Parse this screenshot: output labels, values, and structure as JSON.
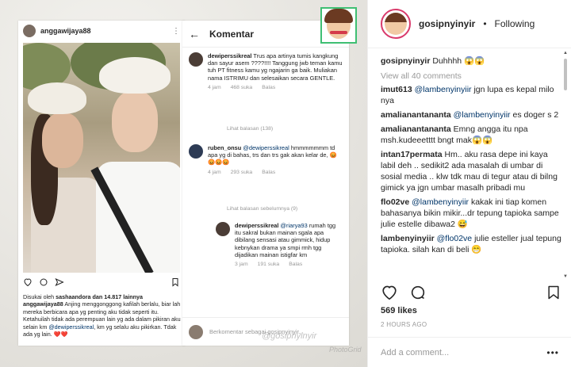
{
  "collage": {
    "post": {
      "username": "anggawijaya88",
      "more": "⋮",
      "liked_by_prefix": "Disukai oleh",
      "liked_by_user": "sashaandora",
      "liked_by_suffix": "dan 14.817 lainnya",
      "caption_user": "anggawijaya88",
      "caption": "Anjing menggonggong kafilah berlalu, biar lah mereka berbicara apa yg penting aku tidak seperti itu. Ketahuilah tidak ada perempuan lain yg ada dalam pikiran aku selain km",
      "caption_mention": "@dewiperssikreal",
      "caption_end": ", km yg selalu aku pikirkan. Tdak ada yg lain. ❤️❤️"
    },
    "comments_screen": {
      "back": "←",
      "title": "Komentar",
      "c1_user": "dewiperssikreal",
      "c1_text": "Trus apa artinya tumis kangkung dan sayur asem ????!!!! Tanggung jwb teman kamu tuh PT fitness kamu yg ngajarin ga baik. Muliakan nama ISTRIMU dan selesaikan secara GENTLE.",
      "c1_time": "4 jam",
      "c1_likes": "468 suka",
      "c1_reply": "Balas",
      "c1_view": "Lihat balasan (138)",
      "c2_user": "ruben_onsu",
      "c2_mention": "@dewiperssikreal",
      "c2_text": "hmmmmmmm td apa yg di bahas, trs dan trs gak akan kelar de,",
      "c2_emoji": "😡😡😡😡",
      "c2_time": "4 jam",
      "c2_likes": "293 suka",
      "c2_reply": "Balas",
      "c2_view": "Lihat balasan sebelumnya (9)",
      "c3_user": "dewiperssikreal",
      "c3_mention": "@riarya93",
      "c3_text": "rumah tgg itu sakral bukan mainan sgala apa dibilang sensasi atau gimmick, hidup kebnykan drama ya smpi rmh tgg dijadikan mainan istigfar km",
      "c3_time": "3 jam",
      "c3_likes": "191 suka",
      "c3_reply": "Balas",
      "footer_placeholder": "Berkomentar sebagai gosipnyinyir..."
    },
    "watermark": "@gosipnyinyir",
    "watermark2": "PhotoGrid"
  },
  "panel": {
    "username": "gosipnyinyir",
    "dot": "•",
    "follow_status": "Following",
    "caption_user": "gosipnyinyir",
    "caption_text": "Duhhhh 😱😱",
    "view_all": "View all 40 comments",
    "comments": [
      {
        "user": "imut613",
        "mention": "@lambenyinyiir",
        "text": "jgn lupa es kepal milo nya"
      },
      {
        "user": "amalianantananta",
        "mention": "@lambenyinyiir",
        "text": "es doger s 2"
      },
      {
        "user": "amalianantananta",
        "mention": "",
        "text": "Emng angga itu npa msh.kudeeetttt bngt mak😱😱"
      },
      {
        "user": "intan17permata",
        "mention": "",
        "text": "Hm.. aku rasa depe ini kaya labil deh .. sedikit2 ada masalah di umbar di sosial media .. klw tdk mau di tegur atau di bilng gimick ya jgn umbar masalh pribadi mu"
      },
      {
        "user": "flo02ve",
        "mention": "@lambenyinyiir",
        "text": "kakak ini tiap komen bahasanya bikin mikir...dr tepung tapioka sampe julie estelle dibawa2 😅"
      },
      {
        "user": "lambenyinyiir",
        "mention": "@flo02ve",
        "text": "julie esteller jual tepung tapioka. silah kan di beli 😁"
      }
    ],
    "likes": "569 likes",
    "time": "2 HOURS AGO",
    "add_comment_placeholder": "Add a comment...",
    "more": "•••"
  },
  "colors": {
    "link": "#003569",
    "muted": "#999999",
    "logo_border": "#3fbf73",
    "story_ring": "#d93a6b"
  }
}
